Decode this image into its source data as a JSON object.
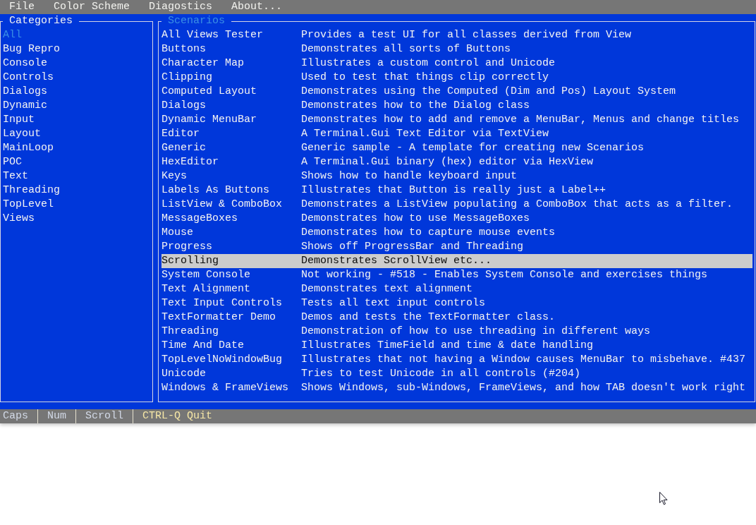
{
  "menu_bar": {
    "items": [
      "File",
      "Color Scheme",
      "Diagostics",
      "About..."
    ]
  },
  "categories": {
    "title": "Categories",
    "focused": false,
    "items": [
      {
        "label": "All",
        "selected": true
      },
      {
        "label": "Bug Repro",
        "selected": false
      },
      {
        "label": "Console",
        "selected": false
      },
      {
        "label": "Controls",
        "selected": false
      },
      {
        "label": "Dialogs",
        "selected": false
      },
      {
        "label": "Dynamic",
        "selected": false
      },
      {
        "label": "Input",
        "selected": false
      },
      {
        "label": "Layout",
        "selected": false
      },
      {
        "label": "MainLoop",
        "selected": false
      },
      {
        "label": "POC",
        "selected": false
      },
      {
        "label": "Text",
        "selected": false
      },
      {
        "label": "Threading",
        "selected": false
      },
      {
        "label": "TopLevel",
        "selected": false
      },
      {
        "label": "Views",
        "selected": false
      }
    ]
  },
  "scenarios": {
    "title": "Scenarios",
    "focused": true,
    "items": [
      {
        "name": "All Views Tester",
        "description": "Provides a test UI for all classes derived from View",
        "selected": false
      },
      {
        "name": "Buttons",
        "description": "Demonstrates all sorts of Buttons",
        "selected": false
      },
      {
        "name": "Character Map",
        "description": "Illustrates a custom control and Unicode",
        "selected": false
      },
      {
        "name": "Clipping",
        "description": "Used to test that things clip correctly",
        "selected": false
      },
      {
        "name": "Computed Layout",
        "description": "Demonstrates using the Computed (Dim and Pos) Layout System",
        "selected": false
      },
      {
        "name": "Dialogs",
        "description": "Demonstrates how to the Dialog class",
        "selected": false
      },
      {
        "name": "Dynamic MenuBar",
        "description": "Demonstrates how to add and remove a MenuBar, Menus and change titles",
        "selected": false
      },
      {
        "name": "Editor",
        "description": "A Terminal.Gui Text Editor via TextView",
        "selected": false
      },
      {
        "name": "Generic",
        "description": "Generic sample - A template for creating new Scenarios",
        "selected": false
      },
      {
        "name": "HexEditor",
        "description": "A Terminal.Gui binary (hex) editor via HexView",
        "selected": false
      },
      {
        "name": "Keys",
        "description": "Shows how to handle keyboard input",
        "selected": false
      },
      {
        "name": "Labels As Buttons",
        "description": "Illustrates that Button is really just a Label++",
        "selected": false
      },
      {
        "name": "ListView & ComboBox",
        "description": "Demonstrates a ListView populating a ComboBox that acts as a filter.",
        "selected": false
      },
      {
        "name": "MessageBoxes",
        "description": "Demonstrates how to use MessageBoxes",
        "selected": false
      },
      {
        "name": "Mouse",
        "description": "Demonstrates how to capture mouse events",
        "selected": false
      },
      {
        "name": "Progress",
        "description": "Shows off ProgressBar and Threading",
        "selected": false
      },
      {
        "name": "Scrolling",
        "description": "Demonstrates ScrollView etc...",
        "selected": true
      },
      {
        "name": "System Console",
        "description": "Not working - #518 - Enables System Console and exercises things",
        "selected": false
      },
      {
        "name": "Text Alignment",
        "description": "Demonstrates text alignment",
        "selected": false
      },
      {
        "name": "Text Input Controls",
        "description": "Tests all text input controls",
        "selected": false
      },
      {
        "name": "TextFormatter Demo",
        "description": "Demos and tests the TextFormatter class.",
        "selected": false
      },
      {
        "name": "Threading",
        "description": "Demonstration of how to use threading in different ways",
        "selected": false
      },
      {
        "name": "Time And Date",
        "description": "Illustrates TimeField and time & date handling",
        "selected": false
      },
      {
        "name": "TopLevelNoWindowBug",
        "description": "Illustrates that not having a Window causes MenuBar to misbehave. #437",
        "selected": false
      },
      {
        "name": "Unicode",
        "description": "Tries to test Unicode in all controls (#204)",
        "selected": false
      },
      {
        "name": "Windows & FrameViews",
        "description": "Shows Windows, sub-Windows, FrameViews, and how TAB doesn't work right",
        "selected": false
      }
    ]
  },
  "status_bar": {
    "items": [
      {
        "kind": "indicator",
        "label": "Caps"
      },
      {
        "kind": "indicator",
        "label": "Num"
      },
      {
        "kind": "indicator",
        "label": "Scroll"
      },
      {
        "kind": "shortcut",
        "label": "CTRL-Q Quit"
      }
    ]
  }
}
